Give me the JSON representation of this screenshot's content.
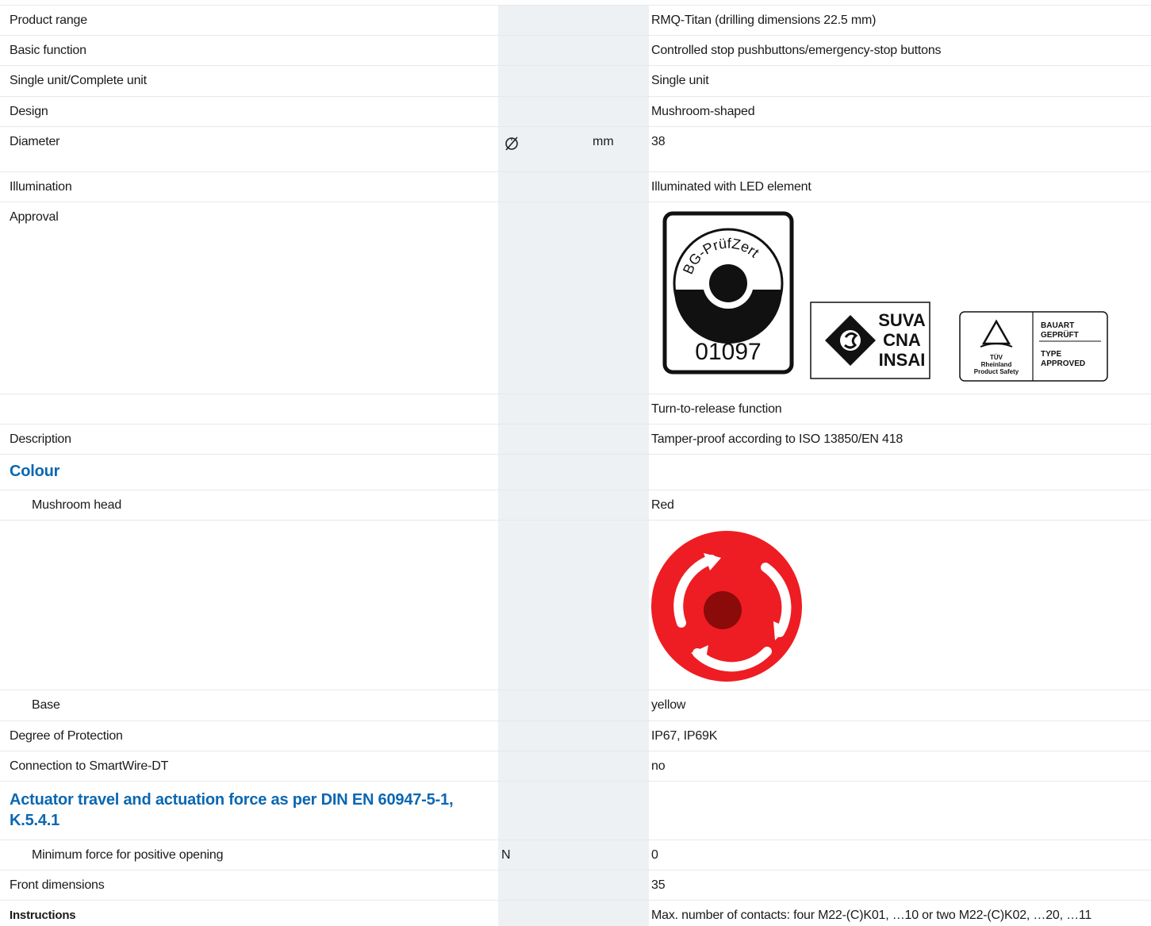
{
  "rows": [
    {
      "label": "Product range",
      "symbol": "",
      "unit": "",
      "value": "RMQ-Titan (drilling dimensions 22.5 mm)"
    },
    {
      "label": "Basic function",
      "symbol": "",
      "unit": "",
      "value": "Controlled stop pushbuttons/emergency-stop buttons"
    },
    {
      "label": "Single unit/Complete unit",
      "symbol": "",
      "unit": "",
      "value": "Single unit"
    },
    {
      "label": "Design",
      "symbol": "",
      "unit": "",
      "value": "Mushroom-shaped"
    },
    {
      "label": "Diameter",
      "symbol": "diameter-icon",
      "unit": "mm",
      "value": "38"
    },
    {
      "label": "Illumination",
      "symbol": "",
      "unit": "",
      "value": "Illuminated with LED element"
    },
    {
      "label": "Approval",
      "symbol": "",
      "unit": "",
      "value": ""
    },
    {
      "label": "",
      "symbol": "",
      "unit": "",
      "value": "Turn-to-release function"
    },
    {
      "label": "Description",
      "symbol": "",
      "unit": "",
      "value": "Tamper-proof according to ISO 13850/EN 418"
    },
    {
      "label": "Colour",
      "section": true
    },
    {
      "label": "Mushroom head",
      "symbol": "",
      "unit": "",
      "value": "Red"
    },
    {
      "label": "",
      "symbol": "",
      "unit": "",
      "value": ""
    },
    {
      "label": "Base",
      "symbol": "",
      "unit": "",
      "value": "yellow"
    },
    {
      "label": "Degree of Protection",
      "symbol": "",
      "unit": "",
      "value": "IP67, IP69K"
    },
    {
      "label": "Connection to SmartWire-DT",
      "symbol": "",
      "unit": "",
      "value": "no"
    },
    {
      "label": "Actuator travel and actuation force as per DIN EN 60947-5-1, K.5.4.1",
      "section": true
    },
    {
      "label": "Minimum force for positive opening",
      "symbol": "N",
      "unit": "",
      "value": "0"
    },
    {
      "label": "Front dimensions",
      "symbol": "",
      "unit": "",
      "value": "35"
    },
    {
      "label": "Instructions",
      "symbol": "",
      "unit": "",
      "value": "Max. number of contacts: four M22-(C)K01, …10 or two M22-(C)K02, …20, …11"
    }
  ],
  "approval_logos": [
    {
      "name": "BG-PrüfZert",
      "number": "01097"
    },
    {
      "name": "SUVA CNA INSAI",
      "lines": [
        "SUVA",
        "CNA",
        "INSAI"
      ]
    },
    {
      "name": "TÜV Rheinland",
      "lines": [
        "TÜV",
        "Rheinland",
        "Product Safety"
      ],
      "right_lines": [
        "BAUART",
        "GEPRÜFT",
        "TYPE",
        "APPROVED"
      ]
    }
  ],
  "colors": {
    "heading_blue": "#0a67b2",
    "gray_column": "#eef1f4",
    "mushroom_red": "#ee1d23",
    "mushroom_center": "#8b0a0a"
  }
}
